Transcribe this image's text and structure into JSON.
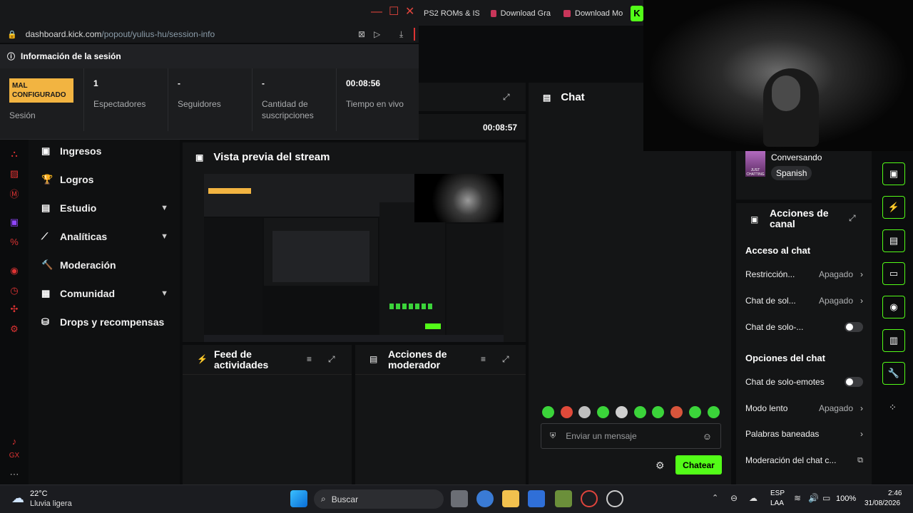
{
  "browser": {
    "tabs": [
      "PS2 ROMs & IS",
      "Download Gra",
      "Download Mo"
    ],
    "url_host": "dashboard.kick.com",
    "url_path": "/popout/yulius-hu/session-info"
  },
  "session": {
    "title": "Información de la sesión",
    "stats": [
      {
        "value": "MAL CONFIGURADO",
        "label": "Sesión"
      },
      {
        "value": "1",
        "label": "Espectadores"
      },
      {
        "value": "-",
        "label": "Seguidores"
      },
      {
        "value": "-",
        "label": "Cantidad de suscripciones"
      },
      {
        "value": "00:08:56",
        "label": "Tiempo en vivo"
      }
    ]
  },
  "header_timer": "00:08:57",
  "sidebar": {
    "items": [
      {
        "label": "Ingresos",
        "icon": "wallet-icon",
        "chevron": false
      },
      {
        "label": "Logros",
        "icon": "trophy-icon",
        "chevron": false
      },
      {
        "label": "Estudio",
        "icon": "studio-icon",
        "chevron": true
      },
      {
        "label": "Analíticas",
        "icon": "analytics-icon",
        "chevron": true
      },
      {
        "label": "Moderación",
        "icon": "hammer-icon",
        "chevron": false
      },
      {
        "label": "Comunidad",
        "icon": "community-icon",
        "chevron": true
      },
      {
        "label": "Drops y recompensas",
        "icon": "gift-icon",
        "chevron": false
      }
    ]
  },
  "preview": {
    "title": "Vista previa del stream"
  },
  "feed": {
    "title": "Feed de actividades"
  },
  "mod_actions": {
    "title": "Acciones de moderador"
  },
  "chat": {
    "title": "Chat",
    "placeholder": "Enviar un mensaje",
    "send_label": "Chatear"
  },
  "stream_info": {
    "category": "Conversando",
    "tag": "Spanish",
    "thumb_text": "JUST CHATTING"
  },
  "channel_actions": {
    "title": "Acciones de canal",
    "access_heading": "Acceso al chat",
    "access_rows": [
      {
        "label": "Restricción...",
        "value": "Apagado",
        "type": "select"
      },
      {
        "label": "Chat de sol...",
        "value": "Apagado",
        "type": "select"
      },
      {
        "label": "Chat de solo-...",
        "type": "toggle",
        "on": false
      }
    ],
    "options_heading": "Opciones del chat",
    "option_rows": [
      {
        "label": "Chat de solo-emotes",
        "type": "toggle",
        "on": false
      },
      {
        "label": "Modo lento",
        "value": "Apagado",
        "type": "select"
      },
      {
        "label": "Palabras baneadas",
        "type": "link"
      },
      {
        "label": "Moderación del chat c...",
        "type": "external"
      }
    ]
  },
  "taskbar": {
    "weather_temp": "22°C",
    "weather_desc": "Lluvia ligera",
    "search_label": "Buscar",
    "lang_top": "ESP",
    "lang_bottom": "LAA",
    "battery": "100%",
    "time": "2:46",
    "date": "31/08/2026"
  },
  "colors": {
    "accent": "#53fc18",
    "badge": "#f2b441",
    "window_close": "#e0443c"
  }
}
